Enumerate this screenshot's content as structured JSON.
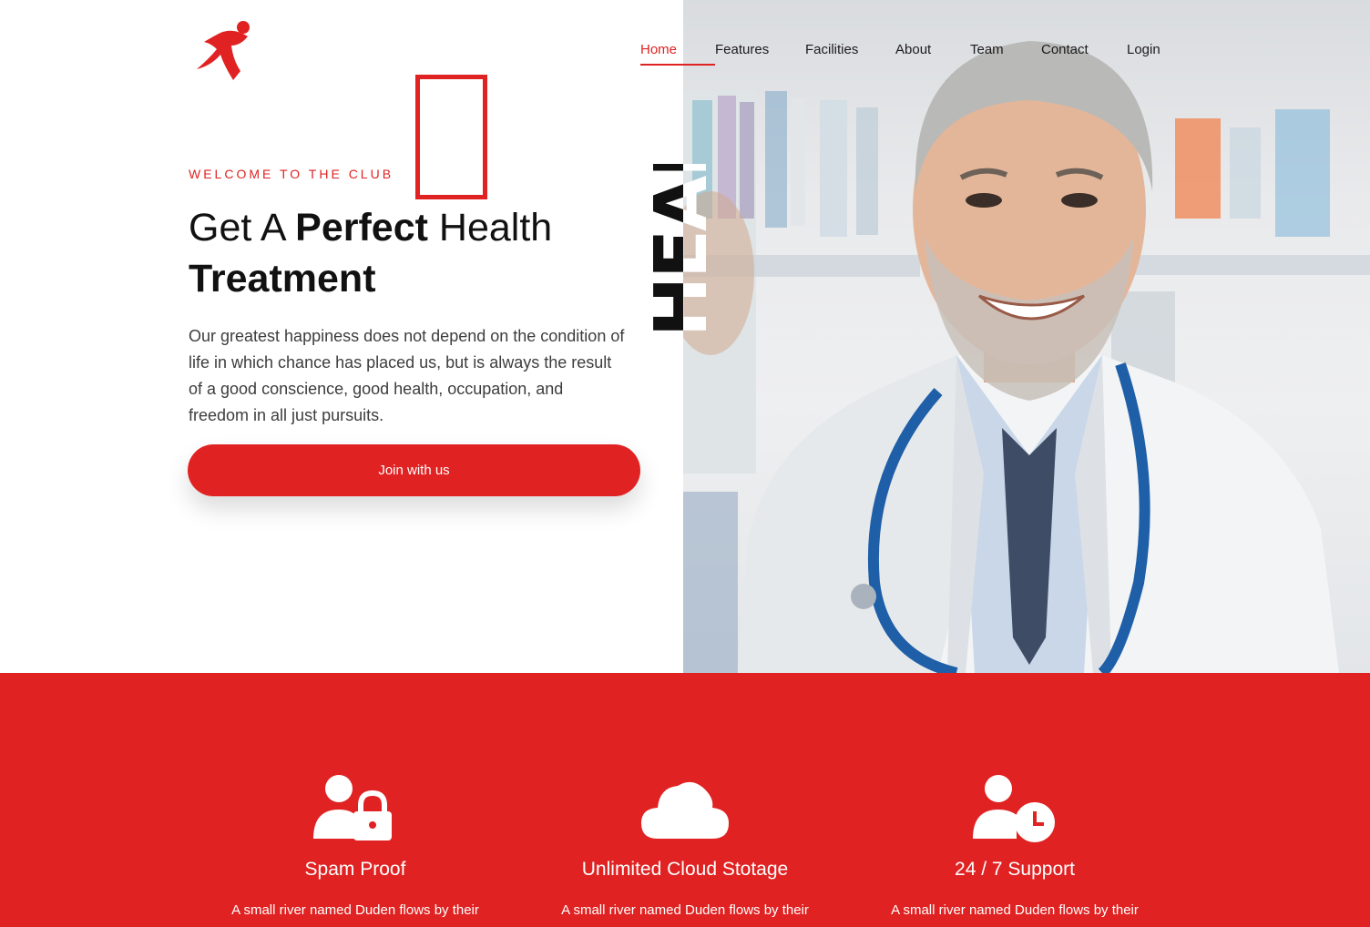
{
  "brand": {
    "logo_icon": "running-figure-icon",
    "accent_color": "#e02222"
  },
  "nav": {
    "items": [
      {
        "label": "Home",
        "active": true
      },
      {
        "label": "Features",
        "active": false
      },
      {
        "label": "Facilities",
        "active": false
      },
      {
        "label": "About",
        "active": false
      },
      {
        "label": "Team",
        "active": false
      },
      {
        "label": "Contact",
        "active": false
      },
      {
        "label": "Login",
        "active": false
      }
    ]
  },
  "hero": {
    "eyebrow": "WELCOME TO THE CLUB",
    "headline_part1": "Get A ",
    "headline_bold1": "Perfect",
    "headline_part2": " Health",
    "headline_bold2": "Treatment",
    "lead": "Our greatest happiness does not depend on the condition of life in which chance has placed us, but is always the result of a good conscience, good health, occupation, and freedom in all just pursuits.",
    "cta_label": "Join with us",
    "vertical_word": "HEALTH",
    "photo": "smiling-doctor-photo"
  },
  "features": [
    {
      "icon": "user-lock-icon",
      "title": "Spam Proof",
      "text": "A small river named Duden flows by their"
    },
    {
      "icon": "cloud-icon",
      "title": "Unlimited Cloud Stotage",
      "text": "A small river named Duden flows by their"
    },
    {
      "icon": "user-clock-icon",
      "title": "24 / 7 Support",
      "text": "A small river named Duden flows by their"
    }
  ]
}
